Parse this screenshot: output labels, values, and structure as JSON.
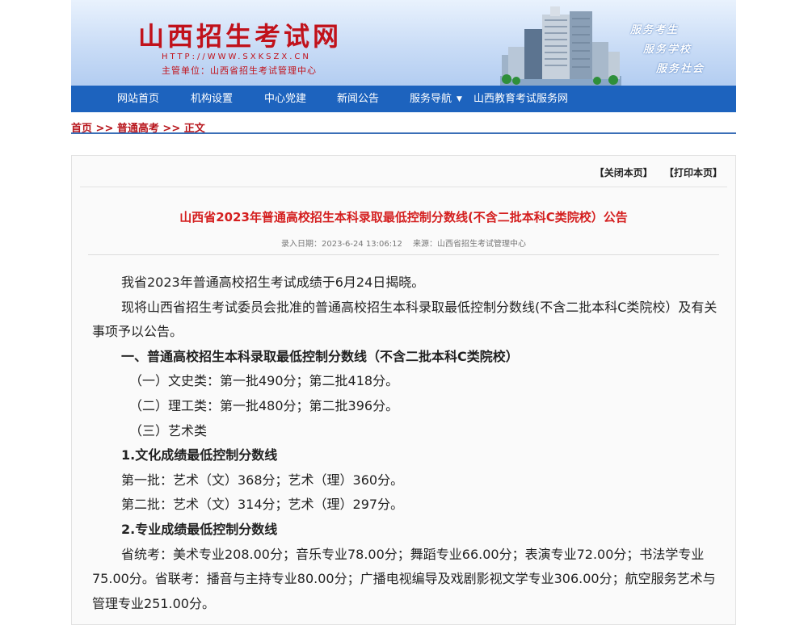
{
  "header": {
    "site_title": "山西招生考试网",
    "site_url": "HTTP://WWW.SXKSZX.CN",
    "authority": "主管单位：山西省招生考试管理中心",
    "slogans": [
      "服务考生",
      "服务学校",
      "服务社会"
    ],
    "building_image": "building-photo"
  },
  "nav": {
    "items": [
      "网站首页",
      "机构设置",
      "中心党建",
      "新闻公告",
      "服务导航",
      "山西教育考试服务网"
    ],
    "dropdown_icon": "caret-down-icon"
  },
  "breadcrumb": {
    "items": [
      "首页",
      "普通高考",
      "正文"
    ],
    "separator": ">>"
  },
  "tools": {
    "close": "【关闭本页】",
    "print": "【打印本页】"
  },
  "article": {
    "title": "山西省2023年普通高校招生本科录取最低控制分数线(不含二批本科C类院校）公告",
    "entry_date": "录入日期：2023-6-24 13:06:12",
    "source": "来源：山西省招生考试管理中心",
    "paragraphs": [
      "我省2023年普通高校招生考试成绩于6月24日揭晓。",
      "现将山西省招生考试委员会批准的普通高校招生本科录取最低控制分数线(不含二批本科C类院校）及有关事项予以公告。",
      "一、普通高校招生本科录取最低控制分数线（不含二批本科C类院校）",
      "（一）文史类：第一批490分；第二批418分。",
      "（二）理工类：第一批480分；第二批396分。",
      "（三）艺术类",
      "1.文化成绩最低控制分数线",
      "第一批：艺术（文）368分；艺术（理）360分。",
      "第二批：艺术（文）314分；艺术（理）297分。",
      "2.专业成绩最低控制分数线",
      "省统考：美术专业208.00分；音乐专业78.00分；舞蹈专业66.00分；表演专业72.00分；书法学专业75.00分。省联考：播音与主持专业80.00分；广播电视编导及戏剧影视文学专业306.00分；航空服务艺术与管理专业251.00分。"
    ]
  },
  "colors": {
    "brand_red": "#c1121b",
    "nav_blue": "#1d63be",
    "title_red": "#d41f1f"
  }
}
